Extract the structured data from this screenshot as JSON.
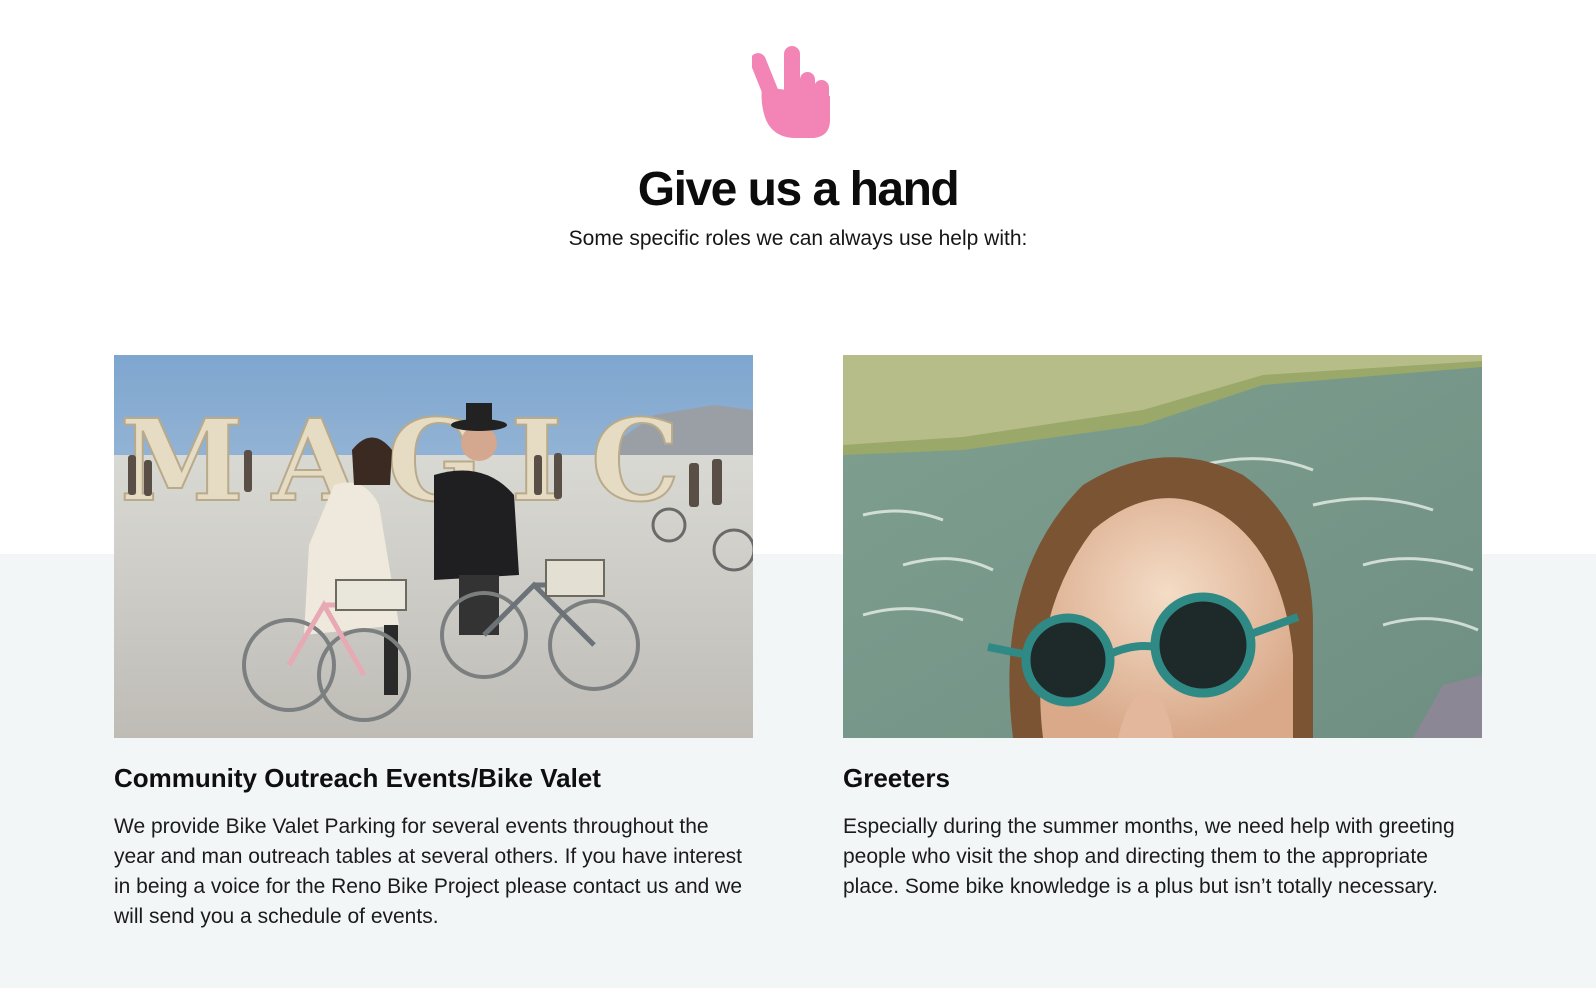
{
  "hero": {
    "icon": "peace-hand-icon",
    "icon_color": "#f285b5",
    "title": "Give us a hand",
    "subtitle": "Some specific roles we can always use help with:"
  },
  "roles": [
    {
      "image": "bike-valet-photo",
      "title": "Community Outreach Events/Bike Valet",
      "description": "We provide Bike Valet Parking for several events throughout the year and man outreach tables at several others. If you have interest in being a voice for the Reno Bike Project please contact us and we will send you a schedule of events."
    },
    {
      "image": "greeter-river-photo",
      "title": "Greeters",
      "description": "Especially during the summer months, we need help with greeting people who visit the shop and directing them to the appropriate place. Some bike knowledge is a plus but isn’t totally necessary."
    }
  ],
  "photo_text": {
    "sign_letters": "MAGIC"
  },
  "colors": {
    "band_background": "#f3f6f7",
    "accent_pink": "#f285b5"
  }
}
